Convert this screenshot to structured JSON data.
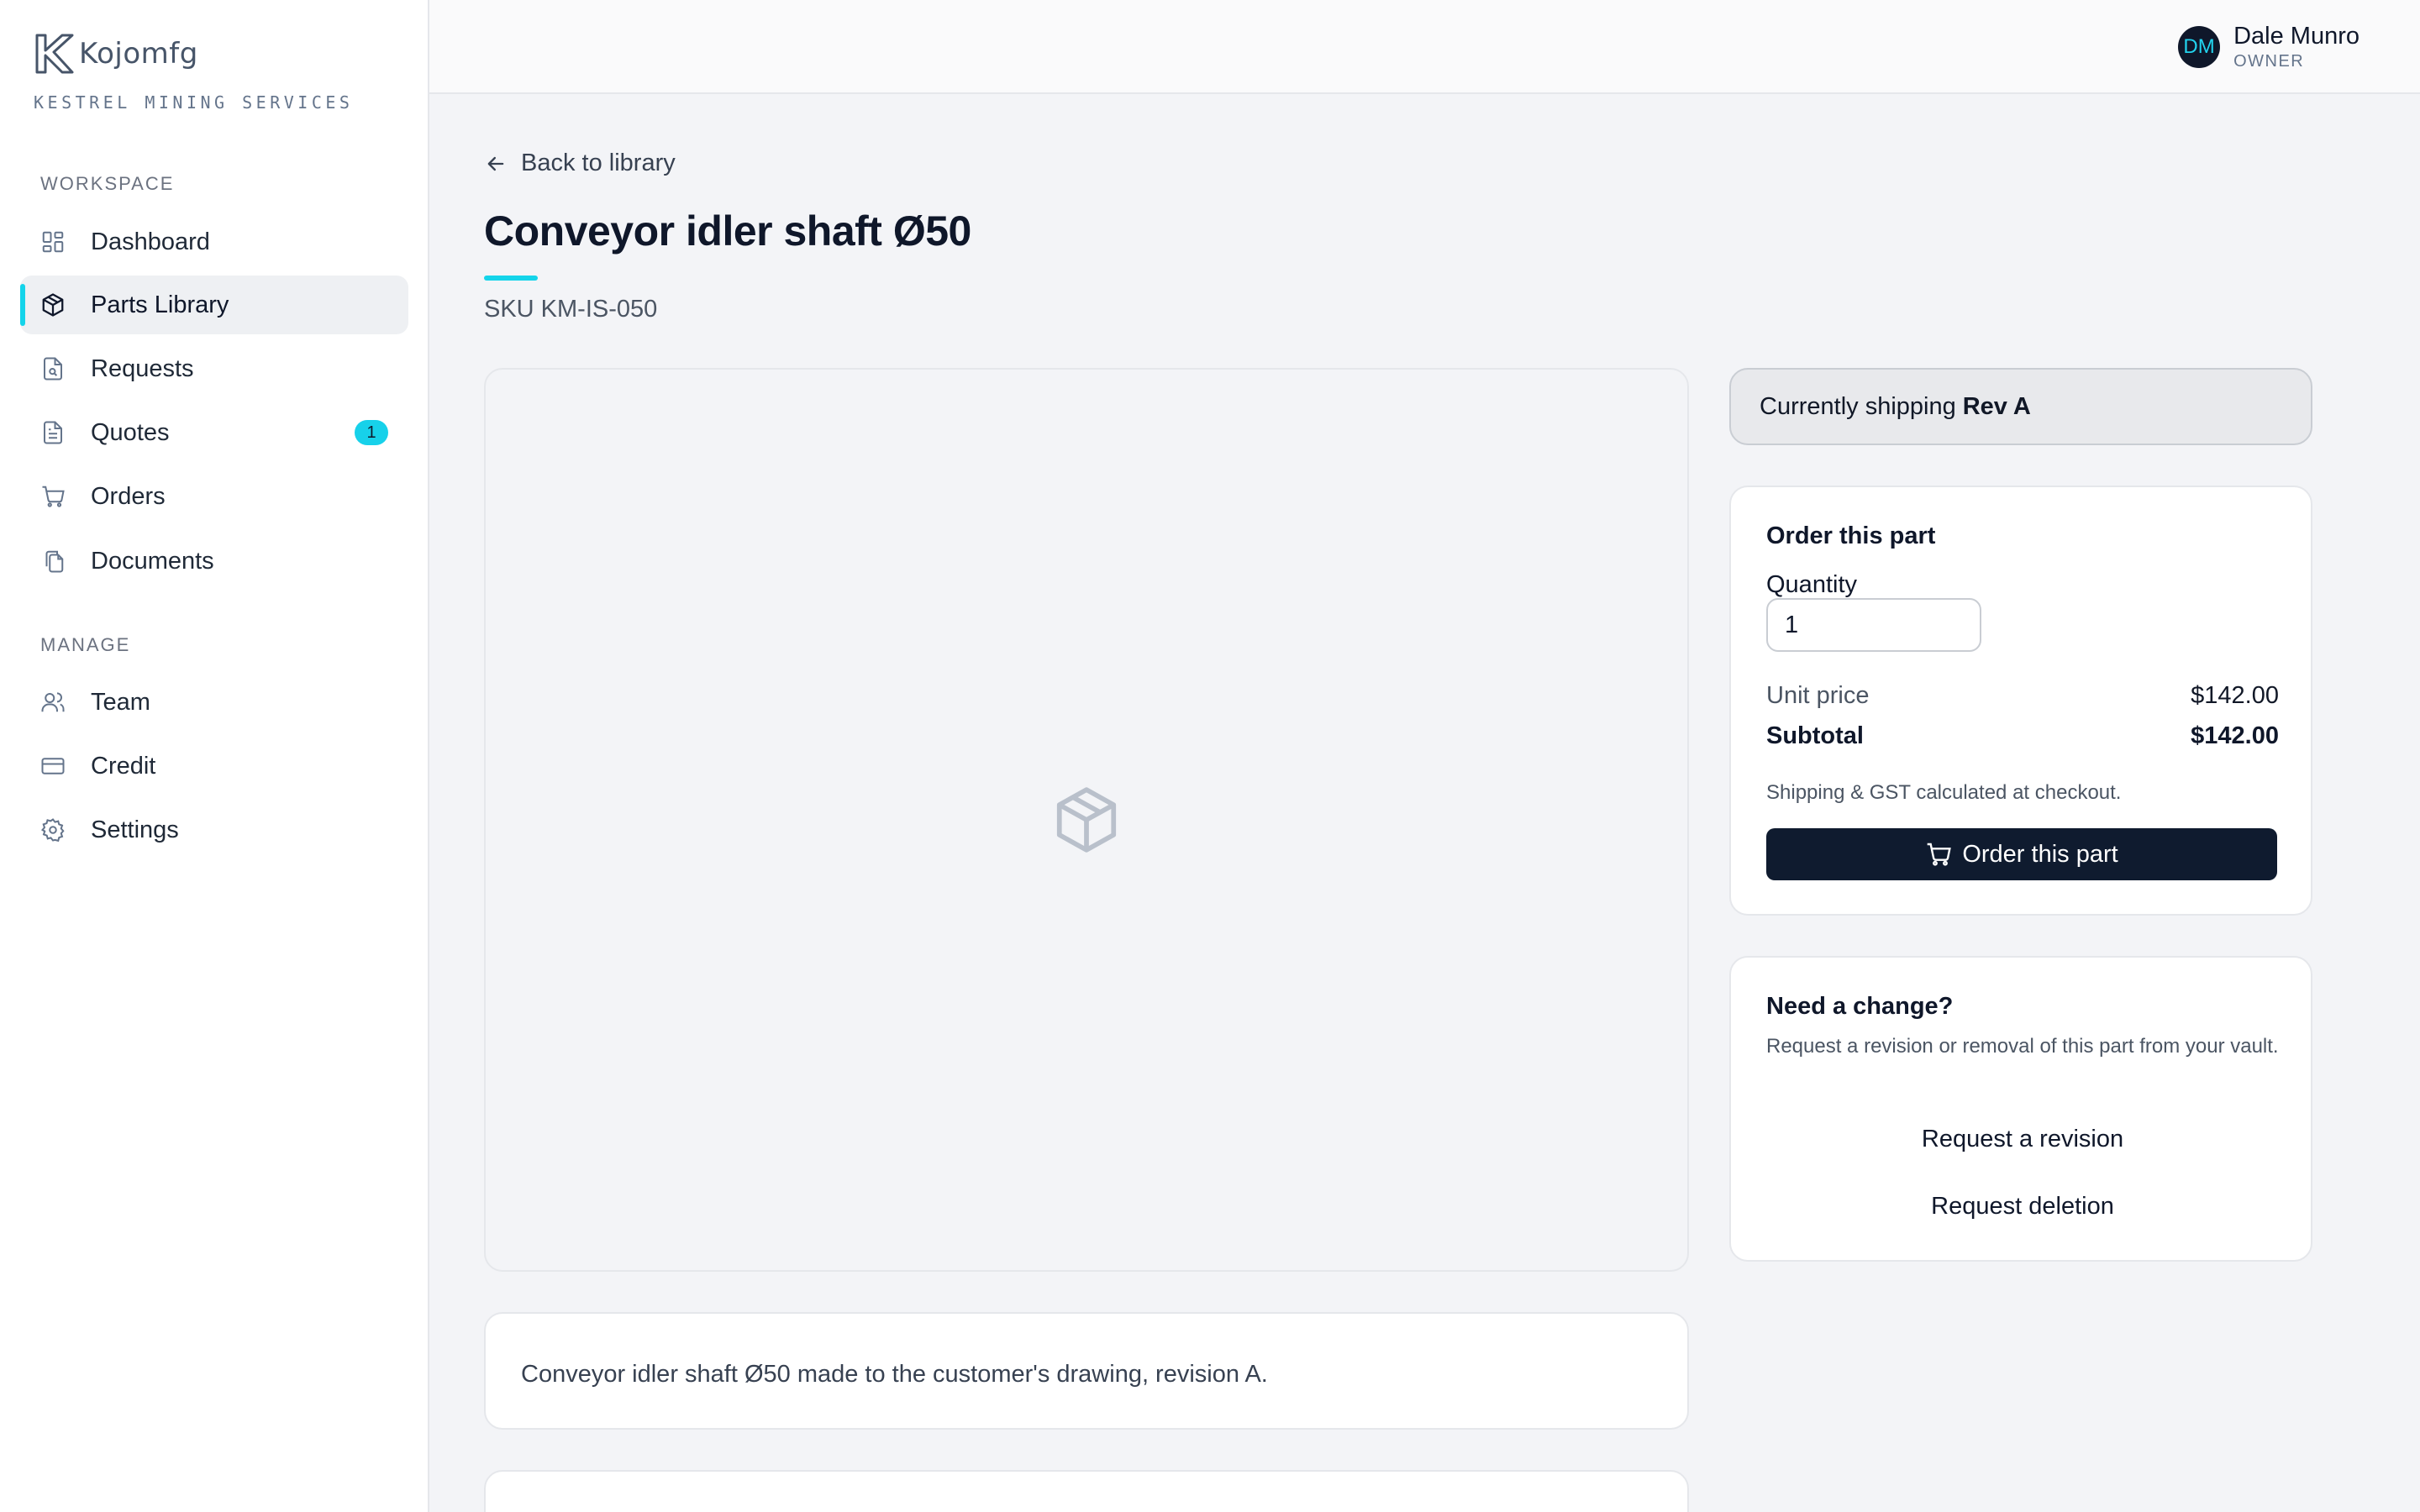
{
  "brand": {
    "name": "Kojomfg",
    "subtitle": "KESTREL MINING SERVICES"
  },
  "sidebar": {
    "sections": [
      {
        "label": "WORKSPACE"
      },
      {
        "label": "MANAGE"
      }
    ],
    "items": [
      {
        "label": "Dashboard",
        "icon": "dashboard-icon"
      },
      {
        "label": "Parts Library",
        "icon": "box-icon",
        "active": true
      },
      {
        "label": "Requests",
        "icon": "file-search-icon"
      },
      {
        "label": "Quotes",
        "icon": "document-icon",
        "badge": "1"
      },
      {
        "label": "Orders",
        "icon": "cart-icon"
      },
      {
        "label": "Documents",
        "icon": "files-icon"
      },
      {
        "label": "Team",
        "icon": "users-icon"
      },
      {
        "label": "Credit",
        "icon": "credit-card-icon"
      },
      {
        "label": "Settings",
        "icon": "gear-icon"
      }
    ]
  },
  "user": {
    "initials": "DM",
    "name": "Dale Munro",
    "role": "OWNER"
  },
  "page": {
    "back_label": "Back to library",
    "title": "Conveyor idler shaft Ø50",
    "sku": "SKU KM-IS-050",
    "description": "Conveyor idler shaft Ø50 made to the customer's drawing, revision A."
  },
  "shipping": {
    "prefix": "Currently shipping",
    "revision": "Rev A"
  },
  "order": {
    "title": "Order this part",
    "quantity_label": "Quantity",
    "quantity_value": "1",
    "unit_price_label": "Unit price",
    "unit_price": "$142.00",
    "subtotal_label": "Subtotal",
    "subtotal": "$142.00",
    "note": "Shipping & GST calculated at checkout.",
    "button_label": "Order this part"
  },
  "change": {
    "title": "Need a change?",
    "description": "Request a revision or removal of this part from your vault.",
    "revision_label": "Request a revision",
    "deletion_label": "Request deletion"
  },
  "colors": {
    "accent": "#14d4ea",
    "primary_button": "#0f1b2f",
    "background": "#f3f4f7"
  }
}
